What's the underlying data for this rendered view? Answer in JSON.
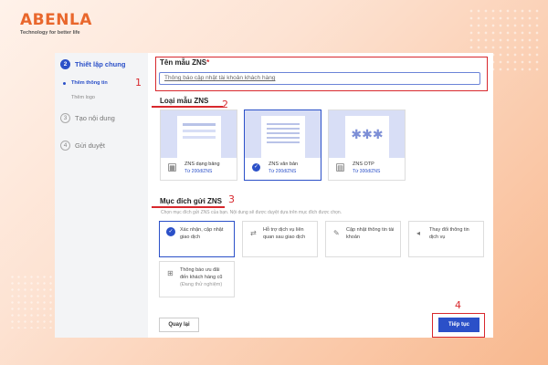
{
  "brand": {
    "name": "ABENLA",
    "tagline": "Technology for better life"
  },
  "sidebar": {
    "steps": [
      {
        "num": "2",
        "label": "Thiết lập chung"
      },
      {
        "num": "3",
        "label": "Tạo nội dung"
      },
      {
        "num": "4",
        "label": "Gửi duyệt"
      }
    ],
    "substeps": [
      {
        "label": "Thêm thông tin"
      },
      {
        "label": "Thêm logo"
      }
    ]
  },
  "annotations": [
    "1",
    "2",
    "3",
    "4"
  ],
  "template_name": {
    "title": "Tên mẫu ZNS",
    "required_mark": "*",
    "value": "Thông báo cập nhật tài khoản khách hàng"
  },
  "template_type": {
    "title": "Loại mẫu ZNS",
    "options": [
      {
        "name": "ZNS dạng bảng",
        "price": "Từ 200đ/ZNS",
        "icon": "table-icon"
      },
      {
        "name": "ZNS văn bản",
        "price": "Từ 200đ/ZNS",
        "icon": "check-icon"
      },
      {
        "name": "ZNS OTP",
        "price": "Từ 300đ/ZNS",
        "icon": "otp-icon"
      }
    ],
    "selected": "ZNS văn bản"
  },
  "purpose": {
    "title": "Mục đích gửi ZNS",
    "description": "Chọn mục đích gửi ZNS của bạn. Nội dung sẽ được duyệt dựa trên mục đích được chọn.",
    "options": [
      {
        "label": "Xác nhận, cập nhật giao dịch",
        "icon": "check-icon"
      },
      {
        "label": "Hỗ trợ dịch vụ liên quan sau giao dịch",
        "icon": "support-icon"
      },
      {
        "label": "Cập nhật thông tin tài khoản",
        "icon": "account-icon"
      },
      {
        "label": "Thay đổi thông tin dịch vụ",
        "icon": "megaphone-icon"
      },
      {
        "label": "Thông báo ưu đãi đến khách hàng cũ",
        "sub": "(Đang thử nghiệm)",
        "icon": "gift-icon"
      }
    ],
    "selected": "Xác nhận, cập nhật giao dịch"
  },
  "actions": {
    "back": "Quay lại",
    "next": "Tiếp tục"
  },
  "colors": {
    "accent": "#2b50c8",
    "annotation": "#d8282d",
    "brand": "#e9672c"
  }
}
